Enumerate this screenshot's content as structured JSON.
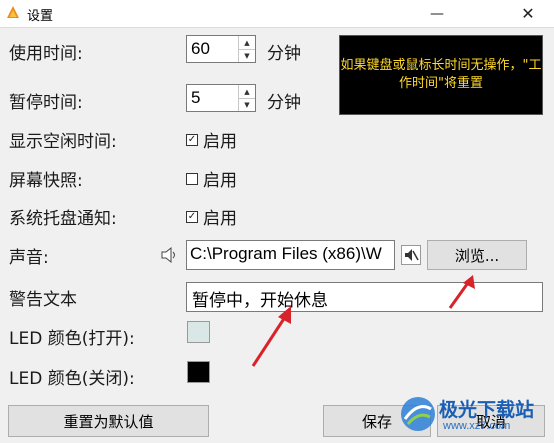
{
  "window": {
    "title": "设置",
    "minimize_icon": "minimize-icon",
    "close_icon": "close-icon"
  },
  "settings": {
    "use_time": {
      "label": "使用时间:",
      "value": "60",
      "unit": "分钟"
    },
    "pause_time": {
      "label": "暂停时间:",
      "value": "5",
      "unit": "分钟"
    },
    "show_idle": {
      "label": "显示空闲时间:",
      "checked": true,
      "option": "启用"
    },
    "screen_snapshot": {
      "label": "屏幕快照:",
      "checked": false,
      "option": "启用"
    },
    "tray_notify": {
      "label": "系统托盘通知:",
      "checked": true,
      "option": "启用"
    },
    "sound": {
      "label": "声音:",
      "path": "C:\\Program Files (x86)\\W",
      "browse": "浏览..."
    },
    "warning_text": {
      "label": "警告文本",
      "value": "暂停中，开始休息"
    },
    "led_on": {
      "label": "LED 颜色(打开):",
      "color": "#d9e8e6"
    },
    "led_off": {
      "label": "LED 颜色(关闭):",
      "color": "#000000"
    }
  },
  "notice": "如果键盘或鼠标长时间无操作，\"工作时间\"将重置",
  "buttons": {
    "reset": "重置为默认值",
    "save": "保存",
    "cancel": "取消"
  },
  "watermark": {
    "text": "极光下载站",
    "url": "www.xz7.com"
  },
  "colors": {
    "accent_arrow": "#d9232b",
    "notice_bg": "#000000",
    "notice_text": "#ffd92a"
  }
}
